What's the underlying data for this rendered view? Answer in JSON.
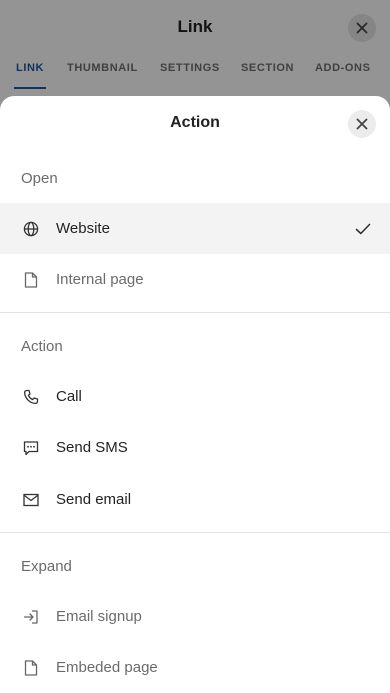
{
  "background": {
    "title": "Link",
    "tabs": [
      "LINK",
      "THUMBNAIL",
      "SETTINGS",
      "SECTION",
      "ADD-ONS"
    ],
    "active_tab": "LINK"
  },
  "sheet": {
    "title": "Action",
    "sections": {
      "open": {
        "label": "Open",
        "items": [
          {
            "label": "Website",
            "icon": "globe-icon",
            "selected": true
          },
          {
            "label": "Internal page",
            "icon": "page-icon",
            "selected": false
          }
        ]
      },
      "action": {
        "label": "Action",
        "items": [
          {
            "label": "Call",
            "icon": "phone-icon"
          },
          {
            "label": "Send SMS",
            "icon": "sms-icon"
          },
          {
            "label": "Send email",
            "icon": "mail-icon"
          }
        ]
      },
      "expand": {
        "label": "Expand",
        "items": [
          {
            "label": "Email signup",
            "icon": "sign-in-icon"
          },
          {
            "label": "Embeded page",
            "icon": "page-icon"
          }
        ]
      }
    }
  },
  "colors": {
    "accent": "#1a5aa5",
    "selected_row": "#f3f3f3",
    "overlay": "rgba(0,0,0,0.42)"
  }
}
